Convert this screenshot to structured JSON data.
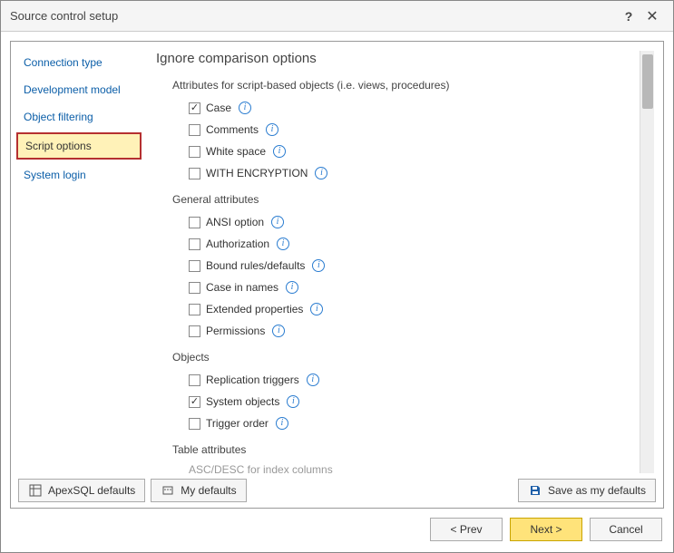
{
  "window": {
    "title": "Source control setup"
  },
  "sidebar": {
    "items": [
      {
        "label": "Connection type"
      },
      {
        "label": "Development model"
      },
      {
        "label": "Object filtering"
      },
      {
        "label": "Script options"
      },
      {
        "label": "System login"
      }
    ],
    "selected_index": 3
  },
  "heading": "Ignore comparison options",
  "sections": [
    {
      "title": "Attributes for script-based objects (i.e. views, procedures)",
      "options": [
        {
          "label": "Case",
          "checked": true
        },
        {
          "label": "Comments",
          "checked": false
        },
        {
          "label": "White space",
          "checked": false
        },
        {
          "label": "WITH ENCRYPTION",
          "checked": false
        }
      ]
    },
    {
      "title": "General attributes",
      "options": [
        {
          "label": "ANSI option",
          "checked": false
        },
        {
          "label": "Authorization",
          "checked": false
        },
        {
          "label": "Bound rules/defaults",
          "checked": false
        },
        {
          "label": "Case in names",
          "checked": false
        },
        {
          "label": "Extended properties",
          "checked": false
        },
        {
          "label": "Permissions",
          "checked": false
        }
      ]
    },
    {
      "title": "Objects",
      "options": [
        {
          "label": "Replication triggers",
          "checked": false
        },
        {
          "label": "System objects",
          "checked": true
        },
        {
          "label": "Trigger order",
          "checked": false
        }
      ]
    },
    {
      "title": "Table attributes",
      "options": []
    }
  ],
  "cutoff_option": "ASC/DESC for index columns",
  "buttons": {
    "apex_defaults": "ApexSQL defaults",
    "my_defaults": "My defaults",
    "save_defaults": "Save as my defaults",
    "prev": "< Prev",
    "next": "Next >",
    "cancel": "Cancel"
  }
}
